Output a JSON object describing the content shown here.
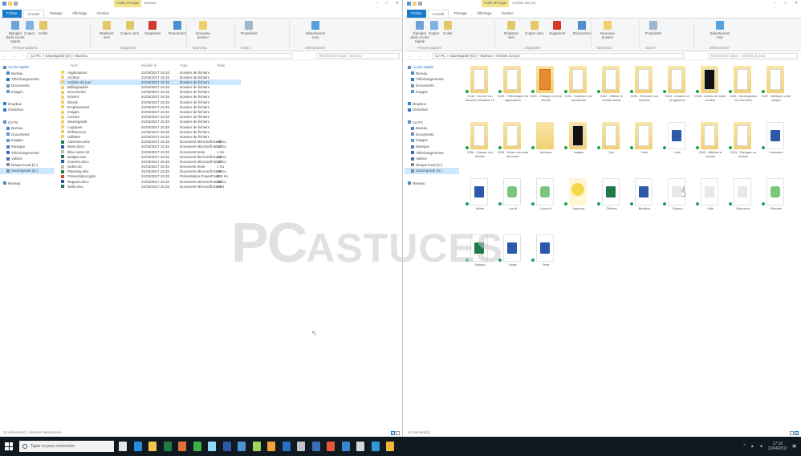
{
  "taskbar": {
    "search_placeholder": "Taper ici pour rechercher",
    "time": "17:16",
    "date": "11/04/2017"
  },
  "watermark": {
    "brand_1": "PC",
    "brand_2": "ASTUCES"
  },
  "left_window": {
    "ctx_tab": "Outils d'image",
    "title": "Bureau",
    "tabs": [
      "Fichier",
      "Accueil",
      "Partage",
      "Affichage",
      "Gestion"
    ],
    "address": "Ce PC > Sauvegarde (D:) > Bureau",
    "search": "Rechercher dans : Bureau",
    "col_headers": [
      "Nom",
      "Modifié le",
      "Type",
      "Taille"
    ],
    "rows": [
      {
        "name": "Applications",
        "date": "21/03/2017 15:33",
        "type": "Dossier de fichiers",
        "size": ""
      },
      {
        "name": "Archive",
        "date": "21/03/2017 15:33",
        "type": "Dossier de fichiers",
        "size": ""
      },
      {
        "name": "Articles du jour",
        "date": "21/03/2017 15:33",
        "type": "Dossier de fichiers",
        "size": ""
      },
      {
        "name": "Bibliographie",
        "date": "21/03/2017 15:33",
        "type": "Dossier de fichiers",
        "size": ""
      },
      {
        "name": "Documents",
        "date": "21/03/2017 15:33",
        "type": "Dossier de fichiers",
        "size": ""
      },
      {
        "name": "Drivers",
        "date": "21/03/2017 15:33",
        "type": "Dossier de fichiers",
        "size": ""
      },
      {
        "name": "Ebook",
        "date": "21/03/2017 15:33",
        "type": "Dossier de fichiers",
        "size": ""
      },
      {
        "name": "Emplacement",
        "date": "21/03/2017 15:33",
        "type": "Dossier de fichiers",
        "size": ""
      },
      {
        "name": "Images",
        "date": "21/03/2017 15:33",
        "type": "Dossier de fichiers",
        "size": ""
      },
      {
        "name": "Lecture",
        "date": "21/03/2017 15:33",
        "type": "Dossier de fichiers",
        "size": ""
      },
      {
        "name": "Sauvegarde",
        "date": "21/03/2017 15:33",
        "type": "Dossier de fichiers",
        "size": ""
      },
      {
        "name": "Logiques",
        "date": "21/03/2017 15:33",
        "type": "Dossier de fichiers",
        "size": ""
      },
      {
        "name": "Références",
        "date": "21/03/2017 15:33",
        "type": "Dossier de fichiers",
        "size": ""
      },
      {
        "name": "Utilitaire",
        "date": "21/03/2017 15:33",
        "type": "Dossier de fichiers",
        "size": ""
      },
      {
        "name": "Adresses.xlsx",
        "date": "21/03/2017 15:33",
        "type": "Document Microsoft Excel",
        "size": "15 Ko"
      },
      {
        "name": "Base.docx",
        "date": "21/03/2017 15:33",
        "type": "Document Microsoft Word",
        "size": "12 Ko"
      },
      {
        "name": "Bloc-notes.txt",
        "date": "21/03/2017 15:33",
        "type": "Document texte",
        "size": "1 Ko"
      },
      {
        "name": "Budget.xlsx",
        "date": "21/03/2017 15:33",
        "type": "Document Microsoft Excel",
        "size": "18 Ko"
      },
      {
        "name": "Courrier.docx",
        "date": "21/03/2017 15:33",
        "type": "Document Microsoft Word",
        "size": "14 Ko"
      },
      {
        "name": "Notes.txt",
        "date": "21/03/2017 15:33",
        "type": "Document texte",
        "size": "1 Ko"
      },
      {
        "name": "Planning.xlsx",
        "date": "21/03/2017 15:33",
        "type": "Document Microsoft Excel",
        "size": "22 Ko"
      },
      {
        "name": "Présentation.pptx",
        "date": "21/03/2017 15:33",
        "type": "Présentation PowerPoint",
        "size": "340 Ko"
      },
      {
        "name": "Rapport.docx",
        "date": "21/03/2017 15:33",
        "type": "Document Microsoft Word",
        "size": "25 Ko"
      },
      {
        "name": "Tarifs.xlsx",
        "date": "21/03/2017 15:33",
        "type": "Document Microsoft Excel",
        "size": "9 Ko"
      }
    ],
    "status": "24 élément(s)    1 élément sélectionné"
  },
  "right_window": {
    "ctx_tab": "Outils d'image",
    "title": "Articles du jour",
    "tabs": [
      "Fichier",
      "Accueil",
      "Partage",
      "Affichage",
      "Gestion"
    ],
    "address": "Ce PC > Sauvegarde (D:) > Bureau > Articles du jour",
    "search": "Rechercher dans : Articles du jour",
    "status": "42 élément(s)",
    "tiles": [
      {
        "label": "0148 - Ouvrez vos dossiers Windows 10",
        "kind": "folder"
      },
      {
        "label": "0149 - Téléchargez les applications",
        "kind": "folder"
      },
      {
        "label": "0150 - Changez le fond d'écran",
        "kind": "folder orange"
      },
      {
        "label": "0151 - Imprimez vos documents",
        "kind": "folder"
      },
      {
        "label": "0152 - Utilisez le bureau virtuel",
        "kind": "folder"
      },
      {
        "label": "0153 - Réduisez vos fenêtres",
        "kind": "folder"
      },
      {
        "label": "0154 - Installez un programme",
        "kind": "folder"
      },
      {
        "label": "0155 - Activez le mode sombre",
        "kind": "folder dark"
      },
      {
        "label": "0156 - Sauvegardez vos données",
        "kind": "folder"
      },
      {
        "label": "0157 - Nettoyez votre disque",
        "kind": "folder"
      },
      {
        "label": "0158 - Classez vos fichiers",
        "kind": "folder"
      },
      {
        "label": "0159 - Gérez vos mots de passe",
        "kind": "folder"
      },
      {
        "label": "Archives",
        "kind": "folder plain"
      },
      {
        "label": "Images",
        "kind": "folder dark"
      },
      {
        "label": "Doc",
        "kind": "folder"
      },
      {
        "label": "Web",
        "kind": "folder"
      },
      {
        "label": "Liste",
        "kind": "doc word"
      },
      {
        "label": "0160 - Affichez le bureau",
        "kind": "folder"
      },
      {
        "label": "0161 - Partagez un dossier",
        "kind": "folder"
      },
      {
        "label": "Sommaire",
        "kind": "doc word"
      },
      {
        "label": "Article",
        "kind": "doc word"
      },
      {
        "label": "Lire.rtf",
        "kind": "doc rtf"
      },
      {
        "label": "Liens.rtf",
        "kind": "doc rtf"
      },
      {
        "label": "Ampoule",
        "kind": "doc light"
      },
      {
        "label": "Chiffres",
        "kind": "doc excel"
      },
      {
        "label": "Brouillon",
        "kind": "doc word"
      },
      {
        "label": "Curseur",
        "kind": "doc gen hand"
      },
      {
        "label": "Vide",
        "kind": "doc gen"
      },
      {
        "label": "Raccourci",
        "kind": "doc gen"
      },
      {
        "label": "Résumé",
        "kind": "doc rtf"
      },
      {
        "label": "Tableau",
        "kind": "doc excel"
      },
      {
        "label": "Notes",
        "kind": "doc word"
      },
      {
        "label": "Texte",
        "kind": "doc word"
      }
    ]
  },
  "nav": [
    {
      "label": "Accès rapide",
      "head": true
    },
    {
      "label": "Bureau",
      "indent": true,
      "color": "#3c8ad6"
    },
    {
      "label": "Téléchargements",
      "indent": true,
      "color": "#2a6fc4"
    },
    {
      "label": "Documents",
      "indent": true,
      "color": "#6c8fb3"
    },
    {
      "label": "Images",
      "indent": true,
      "color": "#5a9bd4"
    },
    {
      "label": "",
      "indent": false,
      "color": ""
    },
    {
      "label": "Dropbox",
      "head": false,
      "color": "#2683d8"
    },
    {
      "label": "OneDrive",
      "head": false,
      "color": "#2b79c7"
    },
    {
      "label": "",
      "indent": false,
      "color": ""
    },
    {
      "label": "Ce PC",
      "head": false,
      "color": "#5b8ec2"
    },
    {
      "label": "Bureau",
      "indent": true,
      "color": "#3c8ad6"
    },
    {
      "label": "Documents",
      "indent": true,
      "color": "#6c8fb3"
    },
    {
      "label": "Images",
      "indent": true,
      "color": "#5a9bd4"
    },
    {
      "label": "Musique",
      "indent": true,
      "color": "#4a7fbf"
    },
    {
      "label": "Téléchargements",
      "indent": true,
      "color": "#2a6fc4"
    },
    {
      "label": "Vidéos",
      "indent": true,
      "color": "#4e6fa6"
    },
    {
      "label": "Disque local (C:)",
      "indent": true,
      "color": "#7f8a94"
    },
    {
      "label": "Sauvegarde (D:)",
      "indent": true,
      "color": "#7f8a94",
      "sel": true
    },
    {
      "label": "",
      "indent": false,
      "color": ""
    },
    {
      "label": "Réseau",
      "head": false,
      "color": "#4d86c6"
    }
  ],
  "ribbon": {
    "buttons": [
      "Épingler dans Accès rapide",
      "Copier",
      "Coller",
      "Déplacer vers",
      "Copier vers",
      "Supprimer",
      "Renommer",
      "Nouveau dossier",
      "Propriétés",
      "Sélectionner tout"
    ],
    "groups": [
      "Presse-papiers",
      "Organiser",
      "Nouveau",
      "Ouvrir",
      "Sélectionner"
    ],
    "colors": [
      "#6fa3d8",
      "#7fb2e0",
      "#e3c86a",
      "#e3c86a",
      "#e3c86a",
      "#d33b2f",
      "#4d8fd1",
      "#f0cf6b",
      "#9db6cc",
      "#58a0dc"
    ]
  },
  "colors": {
    "accent": "#1979ca",
    "selection": "#cce8ff",
    "sync": "#21a152"
  }
}
